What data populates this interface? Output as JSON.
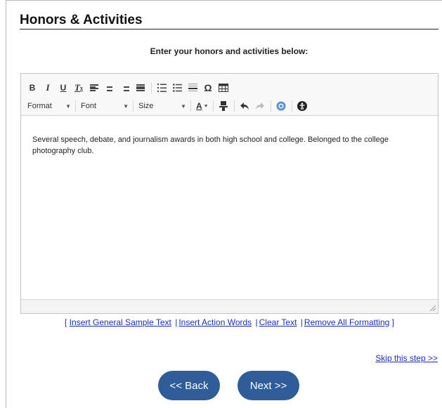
{
  "page": {
    "title": "Honors & Activities",
    "instruction": "Enter your honors and activities below:"
  },
  "toolbar": {
    "row1": {
      "bold": "B",
      "italic": "I",
      "underline": "U",
      "clear_format": "T",
      "clear_format_sub": "x",
      "special_char": "Ω"
    },
    "row2": {
      "format_label": "Format",
      "font_label": "Font",
      "size_label": "Size",
      "text_color_label": "A"
    }
  },
  "editor": {
    "text": "Several speech, debate, and journalism awards in both high school and college. Belonged to the college photography club."
  },
  "links": {
    "open_bracket": "[",
    "insert_general": "Insert General Sample Text",
    "insert_action": "Insert Action Words",
    "clear_text": "Clear Text",
    "remove_formatting": "Remove All Formatting",
    "close_bracket": "]",
    "separator": "|"
  },
  "skip_label": "Skip this step >>",
  "buttons": {
    "back": "<< Back",
    "next": "Next >>"
  },
  "colors": {
    "button_bg": "#2e5d9a",
    "link": "#1a2fbf"
  }
}
